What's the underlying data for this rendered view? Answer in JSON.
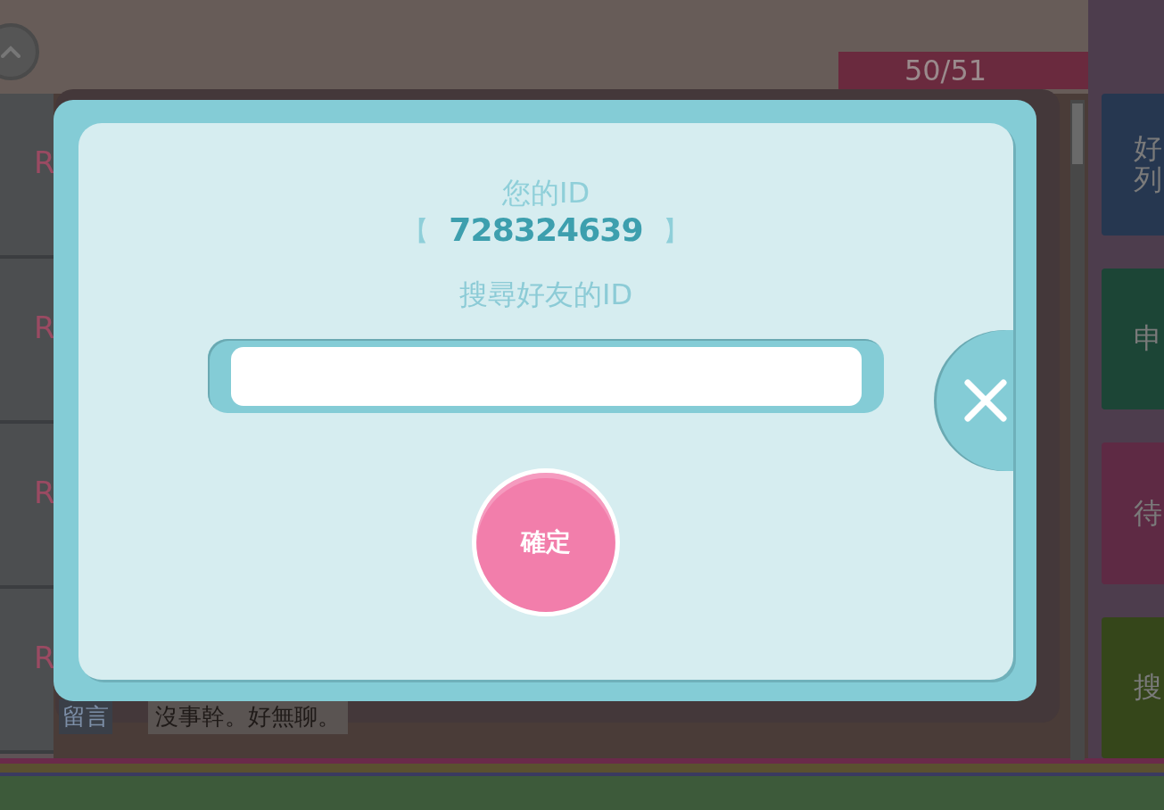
{
  "background": {
    "counter": "50/51",
    "list_rows": [
      {
        "badge": "R"
      },
      {
        "badge": "R"
      },
      {
        "badge": "R"
      },
      {
        "badge": "R"
      }
    ],
    "message": {
      "label": "留言",
      "text": "沒事幹。好無聊。"
    },
    "side_buttons": [
      {
        "label": "好列",
        "color": "#263750"
      },
      {
        "label": "申",
        "color": "#1c4536"
      },
      {
        "label": "待",
        "color": "#5e2a44"
      },
      {
        "label": "搜",
        "color": "#35461a"
      }
    ]
  },
  "dialog": {
    "id_label": "您的ID",
    "open_bracket": "【",
    "id_value": "728324639",
    "close_bracket": "】",
    "search_label": "搜尋好友的ID",
    "confirm_button": "確定"
  }
}
